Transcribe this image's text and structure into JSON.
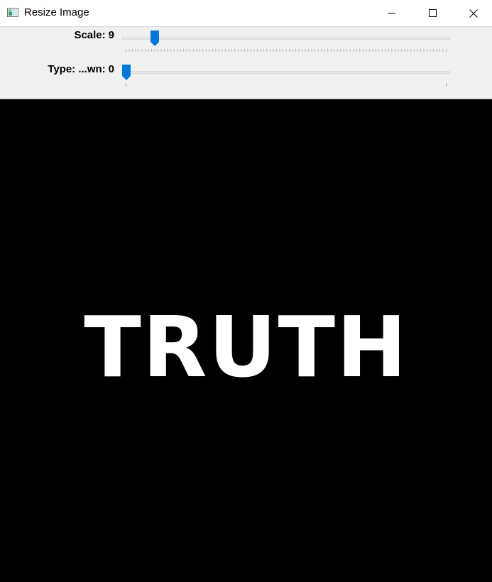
{
  "window": {
    "title": "Resize Image"
  },
  "trackbars": [
    {
      "label": "Scale:",
      "value": "9",
      "min": 0,
      "max": 100,
      "position": 9
    },
    {
      "label": "Type: ...wn:",
      "value": "0",
      "min": 0,
      "max": 1,
      "position": 0
    }
  ],
  "image": {
    "text": "TRUTH",
    "background": "#000000",
    "text_color": "#ffffff"
  },
  "colors": {
    "thumb": "#0078d7",
    "panel_bg": "#f0f0f0"
  },
  "icons": {
    "app": "image-window-icon",
    "minimize": "minimize-icon",
    "maximize": "maximize-icon",
    "close": "close-icon"
  }
}
